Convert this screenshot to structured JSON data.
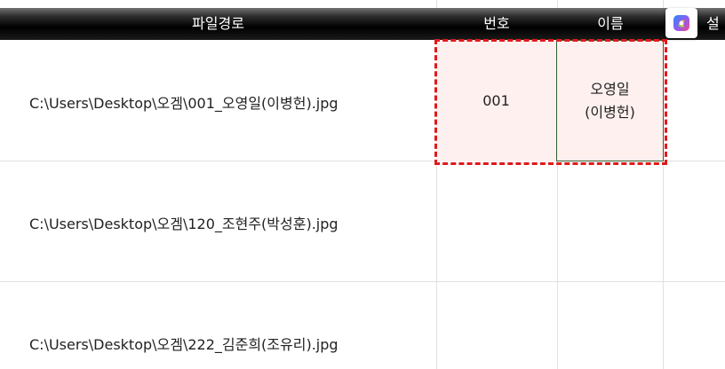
{
  "header": {
    "path_label": "파일경로",
    "number_label": "번호",
    "name_label": "이름",
    "next_label_partial": "설"
  },
  "rows": [
    {
      "path": "C:\\Users\\Desktop\\오겜\\001_오영일(이병헌).jpg",
      "number": "001",
      "name_line1": "오영일",
      "name_line2": "(이병헌)"
    },
    {
      "path": "C:\\Users\\Desktop\\오겜\\120_조현주(박성훈).jpg",
      "number": "",
      "name_line1": "",
      "name_line2": ""
    },
    {
      "path": "C:\\Users\\Desktop\\오겜\\222_김준희(조유리).jpg",
      "number": "",
      "name_line1": "",
      "name_line2": ""
    }
  ],
  "copilot": {
    "icon": "copilot-icon"
  },
  "colors": {
    "header_bg": "#000000",
    "selection_fill": "#fdf0ef",
    "selection_border": "#e0191b",
    "active_cell_border": "#2f5d2f"
  }
}
